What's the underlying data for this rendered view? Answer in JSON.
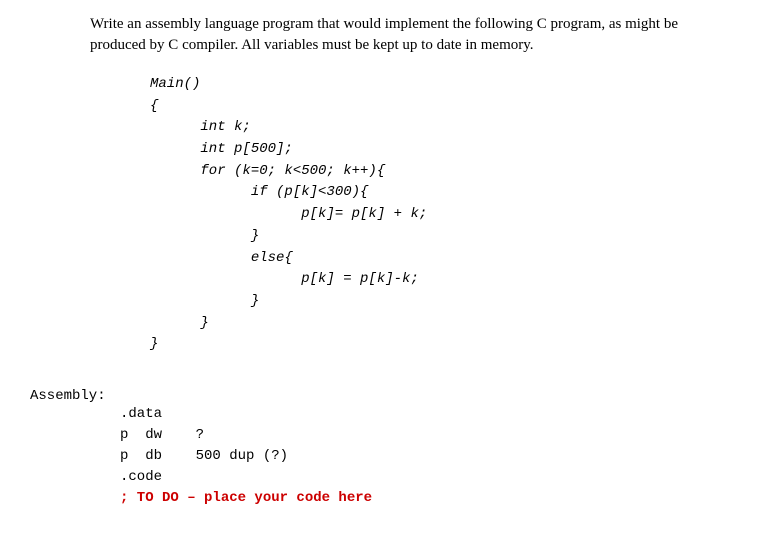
{
  "problem_text": "Write an assembly language program that would implement the following C program, as might be produced by C compiler. All variables must be kept up to date in memory.",
  "c_code": {
    "l1": "Main()",
    "l2": "{",
    "l3": "      int k;",
    "l4": "      int p[500];",
    "l5": "      for (k=0; k<500; k++){",
    "l6": "            if (p[k]<300){",
    "l7": "                  p[k]= p[k] + k;",
    "l8": "            }",
    "l9": "            else{",
    "l10": "                  p[k] = p[k]-k;",
    "l11": "            }",
    "l12": "      }",
    "l13": "}"
  },
  "assembly_label": "Assembly:",
  "assembly_code": {
    "l1": ".data",
    "l2": "p  dw    ?",
    "l3": "p  db    500 dup (?)",
    "l4": "",
    "l5": ".code",
    "l6": "; TO DO – place your code here"
  }
}
